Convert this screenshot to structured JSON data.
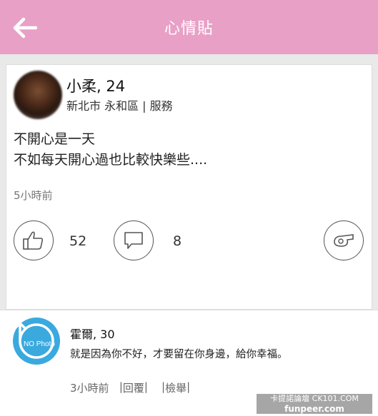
{
  "header": {
    "title": "心情貼",
    "back_icon": "back-arrow-icon"
  },
  "post": {
    "user": {
      "name_age": "小柔, 24",
      "location": "新北市 永和區 | 服務"
    },
    "content": [
      "不開心是一天",
      "不如每天開心過也比較快樂些...."
    ],
    "time": "5小時前",
    "likes": "52",
    "comments": "8"
  },
  "comment": {
    "avatar_text": "NO Photo",
    "name_age": "霍爾, 30",
    "text": "就是因為你不好，才要留在你身邊，給你幸福。",
    "time": "3小時前",
    "reply_label": "回覆",
    "report_label": "檢舉"
  },
  "watermark": {
    "line1": "卡提諾論壇 CK101.COM",
    "line2": "funpeer.com"
  },
  "colors": {
    "header": "#e8a0c6",
    "avatar_blue": "#3aa9de"
  }
}
